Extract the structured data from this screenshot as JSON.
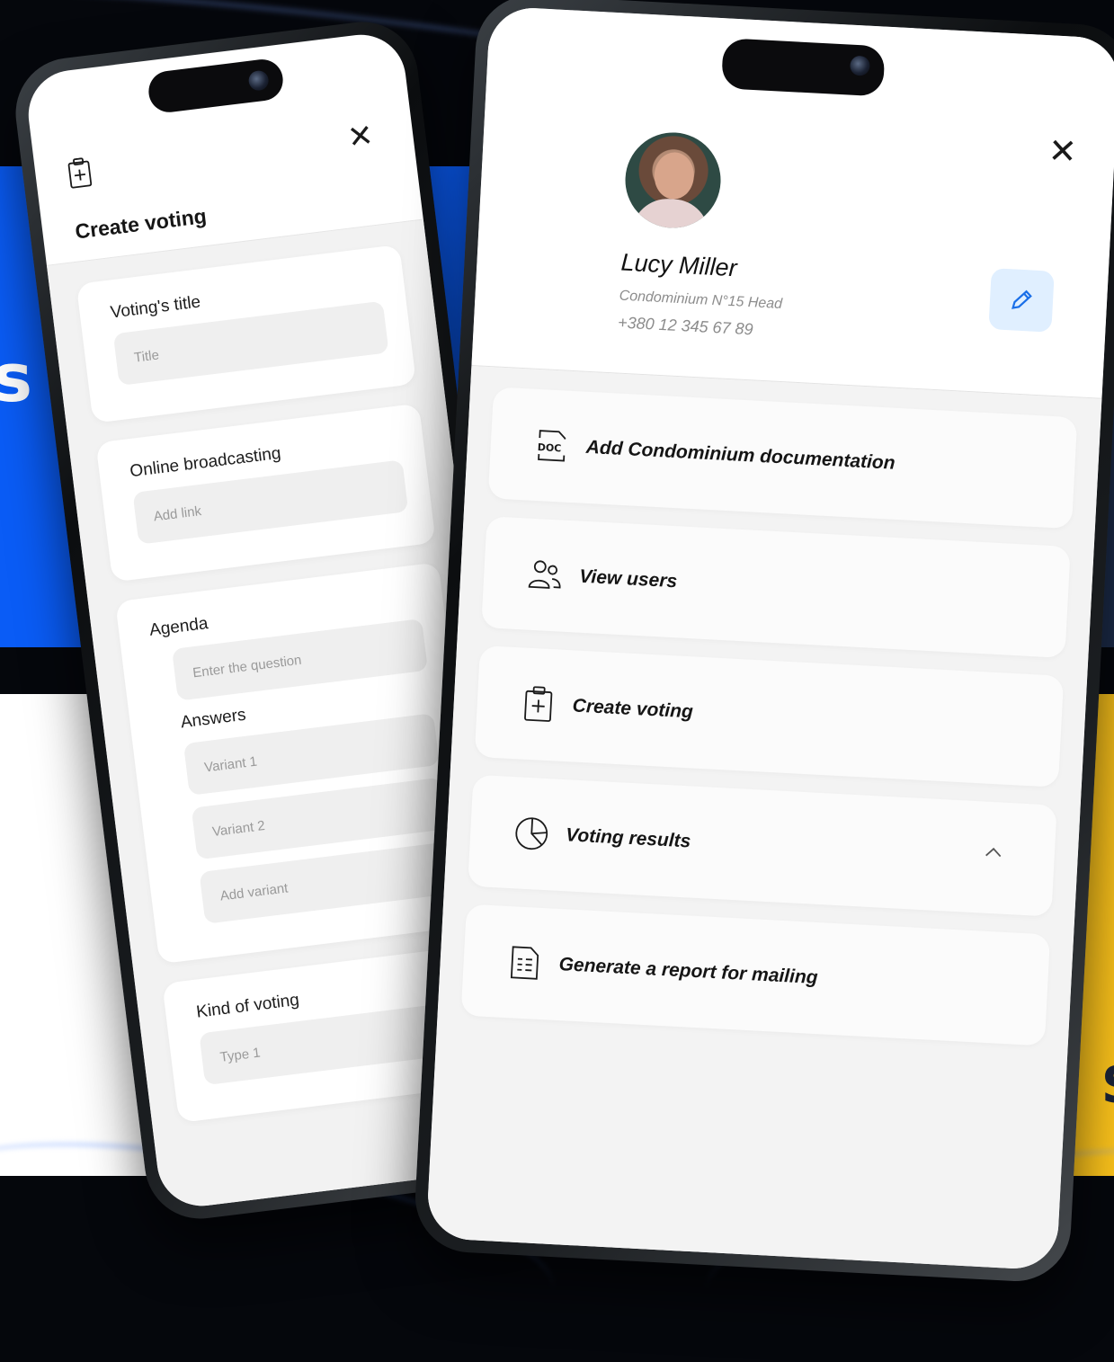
{
  "colors": {
    "blue_panel": "#0a5cf6",
    "yellow_panel": "#f9c11b",
    "edit_button_bg": "#e0efff"
  },
  "background": {
    "left_letter": "s",
    "right_letter": "S"
  },
  "voting_form": {
    "icon": "clipboard-plus-icon",
    "close_icon": "close-icon",
    "close_glyph": "✕",
    "title": "Create voting",
    "title_field": {
      "label": "Voting's title",
      "placeholder": "Title"
    },
    "broadcast_field": {
      "label": "Online broadcasting",
      "placeholder": "Add link"
    },
    "agenda": {
      "label": "Agenda",
      "question_placeholder": "Enter the question",
      "answers_label": "Answers",
      "answers": [
        "Variant 1",
        "Variant 2"
      ],
      "add_variant_placeholder": "Add variant"
    },
    "kind_field": {
      "label": "Kind of voting",
      "value": "Type 1"
    }
  },
  "profile_menu": {
    "close_icon": "close-icon",
    "close_glyph": "✕",
    "user": {
      "name": "Lucy Miller",
      "role": "Condominium N°15 Head",
      "phone": "+380 12 345 67 89"
    },
    "edit_icon": "pencil-icon",
    "items": [
      {
        "label": "Add Condominium documentation",
        "icon": "doc-file-icon"
      },
      {
        "label": "View users",
        "icon": "users-icon"
      },
      {
        "label": "Create voting",
        "icon": "clipboard-plus-icon"
      },
      {
        "label": "Voting results",
        "icon": "pie-chart-icon",
        "expanded": true
      },
      {
        "label": "Generate a report for mailing",
        "icon": "report-icon"
      }
    ]
  }
}
